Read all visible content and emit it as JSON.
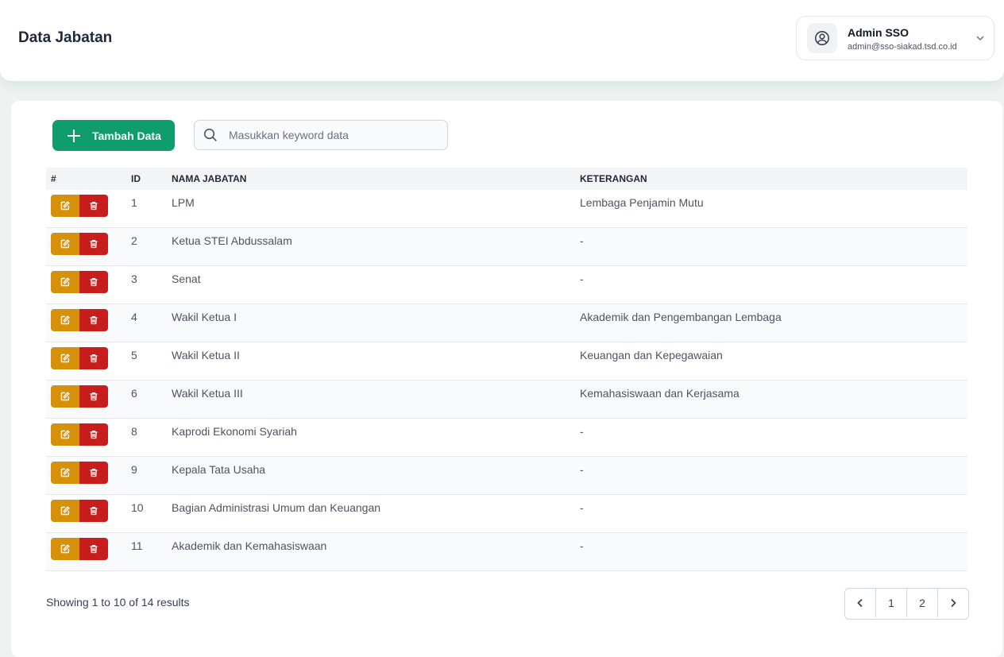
{
  "header": {
    "title": "Data Jabatan",
    "user": {
      "name": "Admin SSO",
      "email": "admin@sso-siakad.tsd.co.id"
    }
  },
  "toolbar": {
    "add_label": "Tambah Data",
    "search_placeholder": "Masukkan keyword data"
  },
  "table": {
    "columns": [
      "#",
      "ID",
      "NAMA JABATAN",
      "KETERANGAN"
    ],
    "rows": [
      {
        "id": "1",
        "nama": "LPM",
        "keterangan": "Lembaga Penjamin Mutu"
      },
      {
        "id": "2",
        "nama": "Ketua STEI Abdussalam",
        "keterangan": "-"
      },
      {
        "id": "3",
        "nama": "Senat",
        "keterangan": "-"
      },
      {
        "id": "4",
        "nama": "Wakil Ketua I",
        "keterangan": "Akademik dan Pengembangan Lembaga"
      },
      {
        "id": "5",
        "nama": "Wakil Ketua II",
        "keterangan": "Keuangan dan Kepegawaian"
      },
      {
        "id": "6",
        "nama": "Wakil Ketua III",
        "keterangan": "Kemahasiswaan dan Kerjasama"
      },
      {
        "id": "8",
        "nama": "Kaprodi Ekonomi Syariah",
        "keterangan": "-"
      },
      {
        "id": "9",
        "nama": "Kepala Tata Usaha",
        "keterangan": "-"
      },
      {
        "id": "10",
        "nama": "Bagian Administrasi Umum dan Keuangan",
        "keterangan": "-"
      },
      {
        "id": "11",
        "nama": "Akademik dan Kemahasiswaan",
        "keterangan": "-"
      }
    ]
  },
  "footer": {
    "summary": "Showing 1 to 10 of 14 results",
    "pages": [
      "1",
      "2"
    ]
  },
  "colors": {
    "primary_green": "#0f9d6e",
    "edit_amber": "#d69109",
    "delete_red": "#c61d1d"
  }
}
